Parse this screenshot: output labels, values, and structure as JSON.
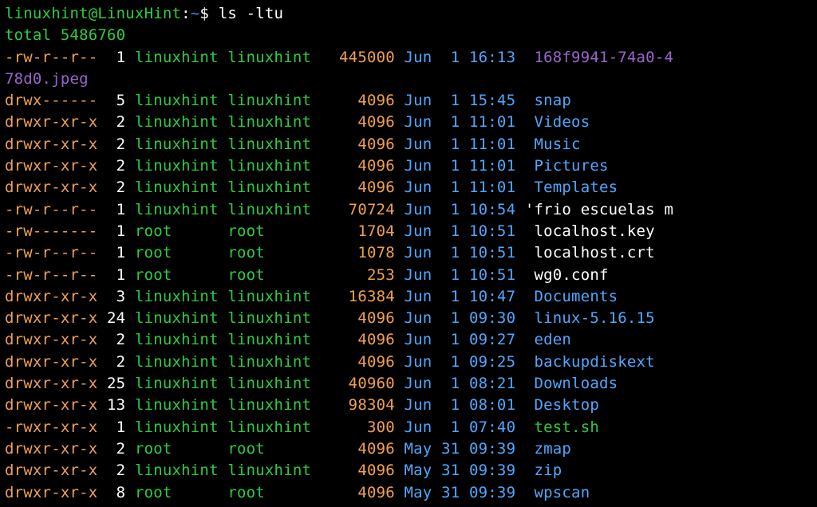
{
  "prompt": {
    "user_host": "linuxhint@LinuxHint",
    "separator": ":",
    "path": "~",
    "symbol": "$",
    "command": "ls -ltu"
  },
  "total_line": "total 5486760",
  "wrapped_filename": "78d0.jpeg",
  "rows": [
    {
      "perms": "-rw-r--r--",
      "links": " 1",
      "owner": "linuxhint",
      "group": "linuxhint",
      "size": "   445000",
      "month": "Jun",
      "day": " 1",
      "time": "16:13",
      "name": " 168f9941-74a0-4",
      "type": "reg"
    },
    {
      "perms": "drwx------",
      "links": " 5",
      "owner": "linuxhint",
      "group": "linuxhint",
      "size": "     4096",
      "month": "Jun",
      "day": " 1",
      "time": "15:45",
      "name": " snap",
      "type": "dir"
    },
    {
      "perms": "drwxr-xr-x",
      "links": " 2",
      "owner": "linuxhint",
      "group": "linuxhint",
      "size": "     4096",
      "month": "Jun",
      "day": " 1",
      "time": "11:01",
      "name": " Videos",
      "type": "dir"
    },
    {
      "perms": "drwxr-xr-x",
      "links": " 2",
      "owner": "linuxhint",
      "group": "linuxhint",
      "size": "     4096",
      "month": "Jun",
      "day": " 1",
      "time": "11:01",
      "name": " Music",
      "type": "dir"
    },
    {
      "perms": "drwxr-xr-x",
      "links": " 2",
      "owner": "linuxhint",
      "group": "linuxhint",
      "size": "     4096",
      "month": "Jun",
      "day": " 1",
      "time": "11:01",
      "name": " Pictures",
      "type": "dir"
    },
    {
      "perms": "drwxr-xr-x",
      "links": " 2",
      "owner": "linuxhint",
      "group": "linuxhint",
      "size": "     4096",
      "month": "Jun",
      "day": " 1",
      "time": "11:01",
      "name": " Templates",
      "type": "dir"
    },
    {
      "perms": "-rw-r--r--",
      "links": " 1",
      "owner": "linuxhint",
      "group": "linuxhint",
      "size": "    70724",
      "month": "Jun",
      "day": " 1",
      "time": "10:54",
      "name": "'frio escuelas m",
      "type": "white"
    },
    {
      "perms": "-rw-------",
      "links": " 1",
      "owner": "root     ",
      "group": "root     ",
      "size": "     1704",
      "month": "Jun",
      "day": " 1",
      "time": "10:51",
      "name": " localhost.key",
      "type": "white"
    },
    {
      "perms": "-rw-r--r--",
      "links": " 1",
      "owner": "root     ",
      "group": "root     ",
      "size": "     1078",
      "month": "Jun",
      "day": " 1",
      "time": "10:51",
      "name": " localhost.crt",
      "type": "white"
    },
    {
      "perms": "-rw-r--r--",
      "links": " 1",
      "owner": "root     ",
      "group": "root     ",
      "size": "      253",
      "month": "Jun",
      "day": " 1",
      "time": "10:51",
      "name": " wg0.conf",
      "type": "white"
    },
    {
      "perms": "drwxr-xr-x",
      "links": " 3",
      "owner": "linuxhint",
      "group": "linuxhint",
      "size": "    16384",
      "month": "Jun",
      "day": " 1",
      "time": "10:47",
      "name": " Documents",
      "type": "dir"
    },
    {
      "perms": "drwxr-xr-x",
      "links": "24",
      "owner": "linuxhint",
      "group": "linuxhint",
      "size": "     4096",
      "month": "Jun",
      "day": " 1",
      "time": "09:30",
      "name": " linux-5.16.15",
      "type": "dir"
    },
    {
      "perms": "drwxr-xr-x",
      "links": " 2",
      "owner": "linuxhint",
      "group": "linuxhint",
      "size": "     4096",
      "month": "Jun",
      "day": " 1",
      "time": "09:27",
      "name": " eden",
      "type": "dir"
    },
    {
      "perms": "drwxr-xr-x",
      "links": " 2",
      "owner": "linuxhint",
      "group": "linuxhint",
      "size": "     4096",
      "month": "Jun",
      "day": " 1",
      "time": "09:25",
      "name": " backupdiskext",
      "type": "dir"
    },
    {
      "perms": "drwxr-xr-x",
      "links": "25",
      "owner": "linuxhint",
      "group": "linuxhint",
      "size": "    40960",
      "month": "Jun",
      "day": " 1",
      "time": "08:21",
      "name": " Downloads",
      "type": "dir"
    },
    {
      "perms": "drwxr-xr-x",
      "links": "13",
      "owner": "linuxhint",
      "group": "linuxhint",
      "size": "    98304",
      "month": "Jun",
      "day": " 1",
      "time": "08:01",
      "name": " Desktop",
      "type": "dir"
    },
    {
      "perms": "-rwxr-xr-x",
      "links": " 1",
      "owner": "linuxhint",
      "group": "linuxhint",
      "size": "      300",
      "month": "Jun",
      "day": " 1",
      "time": "07:40",
      "name": " test.sh",
      "type": "exec"
    },
    {
      "perms": "drwxr-xr-x",
      "links": " 2",
      "owner": "root     ",
      "group": "root     ",
      "size": "     4096",
      "month": "May",
      "day": "31",
      "time": "09:39",
      "name": " zmap",
      "type": "dir"
    },
    {
      "perms": "drwxr-xr-x",
      "links": " 2",
      "owner": "linuxhint",
      "group": "linuxhint",
      "size": "     4096",
      "month": "May",
      "day": "31",
      "time": "09:39",
      "name": " zip",
      "type": "dir"
    },
    {
      "perms": "drwxr-xr-x",
      "links": " 8",
      "owner": "root     ",
      "group": "root     ",
      "size": "     4096",
      "month": "May",
      "day": "31",
      "time": "09:39",
      "name": " wpscan",
      "type": "dir"
    }
  ]
}
